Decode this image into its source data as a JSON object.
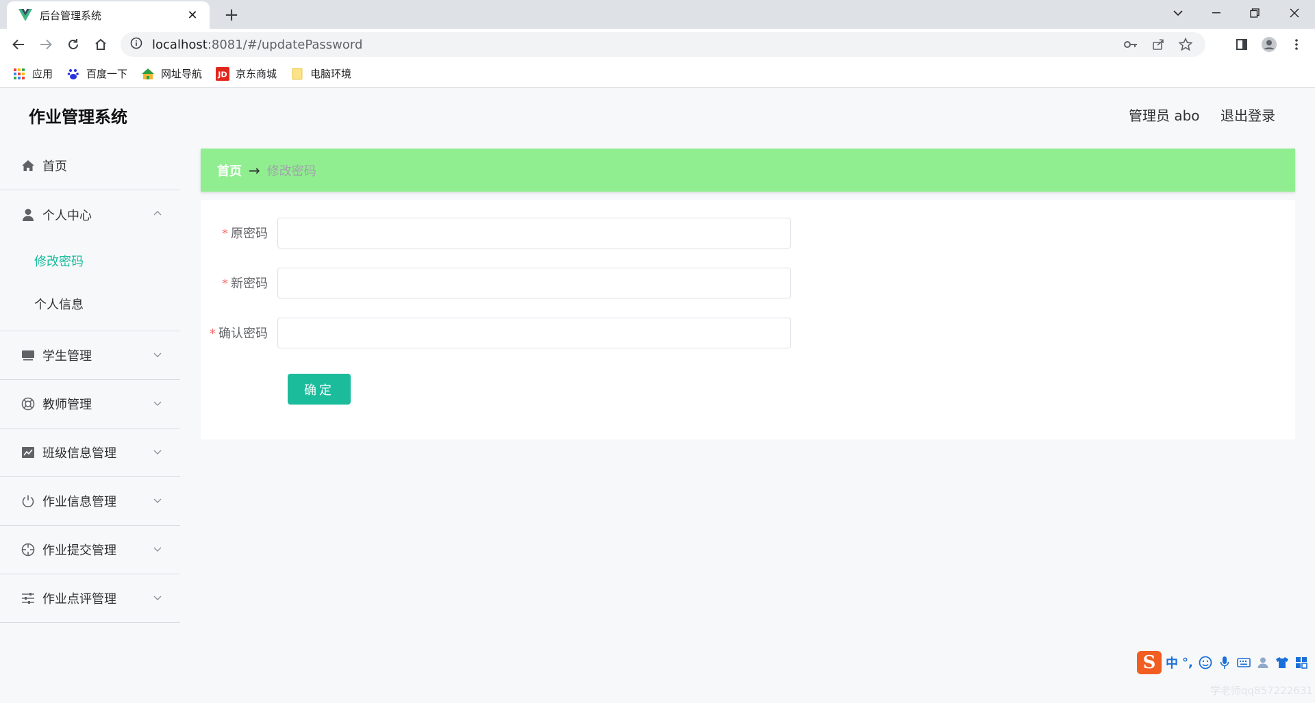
{
  "browser": {
    "tab_title": "后台管理系统",
    "url_host": "localhost",
    "url_path": ":8081/#/updatePassword",
    "bookmarks": [
      {
        "label": "应用",
        "icon": "apps-grid-icon"
      },
      {
        "label": "百度一下",
        "icon": "baidu-paw-icon"
      },
      {
        "label": "网址导航",
        "icon": "nav-site-icon"
      },
      {
        "label": "京东商城",
        "icon": "jd-logo-icon"
      },
      {
        "label": "电脑环境",
        "icon": "folder-icon"
      }
    ]
  },
  "header": {
    "title": "作业管理系统",
    "user": "管理员 abo",
    "logout": "退出登录"
  },
  "sidebar": {
    "items": [
      {
        "label": "首页",
        "icon": "home-icon"
      },
      {
        "label": "个人中心",
        "icon": "user-icon",
        "children": [
          "修改密码",
          "个人信息"
        ]
      },
      {
        "label": "学生管理",
        "icon": "monitor-icon"
      },
      {
        "label": "教师管理",
        "icon": "lifebuoy-icon"
      },
      {
        "label": "班级信息管理",
        "icon": "chart-icon"
      },
      {
        "label": "作业信息管理",
        "icon": "power-icon"
      },
      {
        "label": "作业提交管理",
        "icon": "target-icon"
      },
      {
        "label": "作业点评管理",
        "icon": "sliders-icon"
      }
    ]
  },
  "breadcrumb": {
    "home": "首页",
    "separator": "→",
    "current": "修改密码"
  },
  "form": {
    "fields": [
      {
        "label": "原密码",
        "value": "",
        "placeholder": ""
      },
      {
        "label": "新密码",
        "value": "",
        "placeholder": ""
      },
      {
        "label": "确认密码",
        "value": "",
        "placeholder": ""
      }
    ],
    "required_mark": "*",
    "submit_label": "确定"
  },
  "ime": {
    "logo": "S",
    "lang": "中",
    "punct": "°,"
  },
  "watermark": "学老师qq857222631",
  "colors": {
    "accent": "#1abc9c",
    "breadcrumb_bg": "#90ee90",
    "required": "#f56c6c"
  }
}
